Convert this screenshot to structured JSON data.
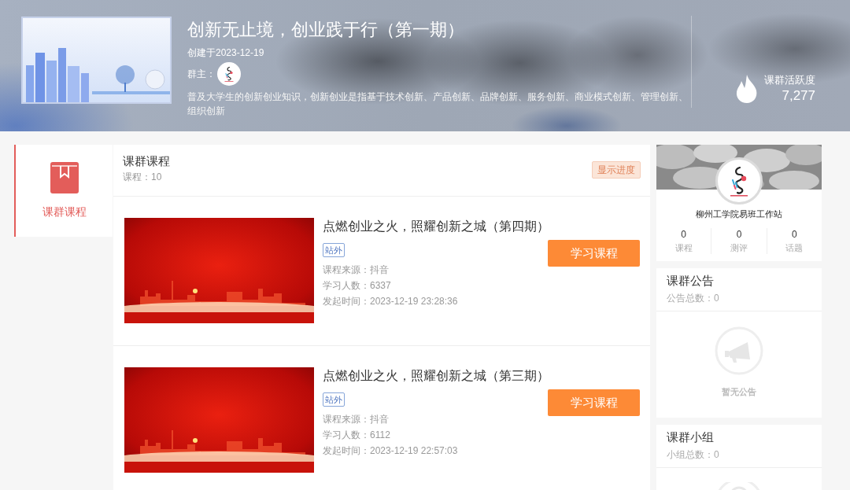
{
  "header": {
    "title": "创新无止境，创业践于行（第一期）",
    "created": "创建于2023-12-19",
    "owner_label": "群主：",
    "description": "普及大学生的创新创业知识，创新创业是指基于技术创新、产品创新、品牌创新、服务创新、商业模式创新、管理创新、组织创新",
    "activity_label": "课群活跃度",
    "activity_value": "7,277"
  },
  "sidebar": {
    "items": [
      {
        "label": "课群课程",
        "selected": true
      }
    ]
  },
  "courses": {
    "title": "课群课程",
    "count": "课程：10",
    "progress_button": "显示进度",
    "items": [
      {
        "title": "点燃创业之火，照耀创新之城（第四期）",
        "tag": "站外",
        "source": "课程来源：抖音",
        "learners": "学习人数：6337",
        "started": "发起时间：2023-12-19 23:28:36",
        "button": "学习课程"
      },
      {
        "title": "点燃创业之火，照耀创新之城（第三期）",
        "tag": "站外",
        "source": "课程来源：抖音",
        "learners": "学习人数：6112",
        "started": "发起时间：2023-12-19 22:57:03",
        "button": "学习课程"
      }
    ]
  },
  "profile": {
    "name": "柳州工学院易班工作站",
    "stats": [
      {
        "value": "0",
        "label": "课程"
      },
      {
        "value": "0",
        "label": "测评"
      },
      {
        "value": "0",
        "label": "话题"
      }
    ]
  },
  "announcements": {
    "title": "课群公告",
    "count": "公告总数：0",
    "empty_text": "暂无公告"
  },
  "groups": {
    "title": "课群小组",
    "count": "小组总数：0"
  }
}
